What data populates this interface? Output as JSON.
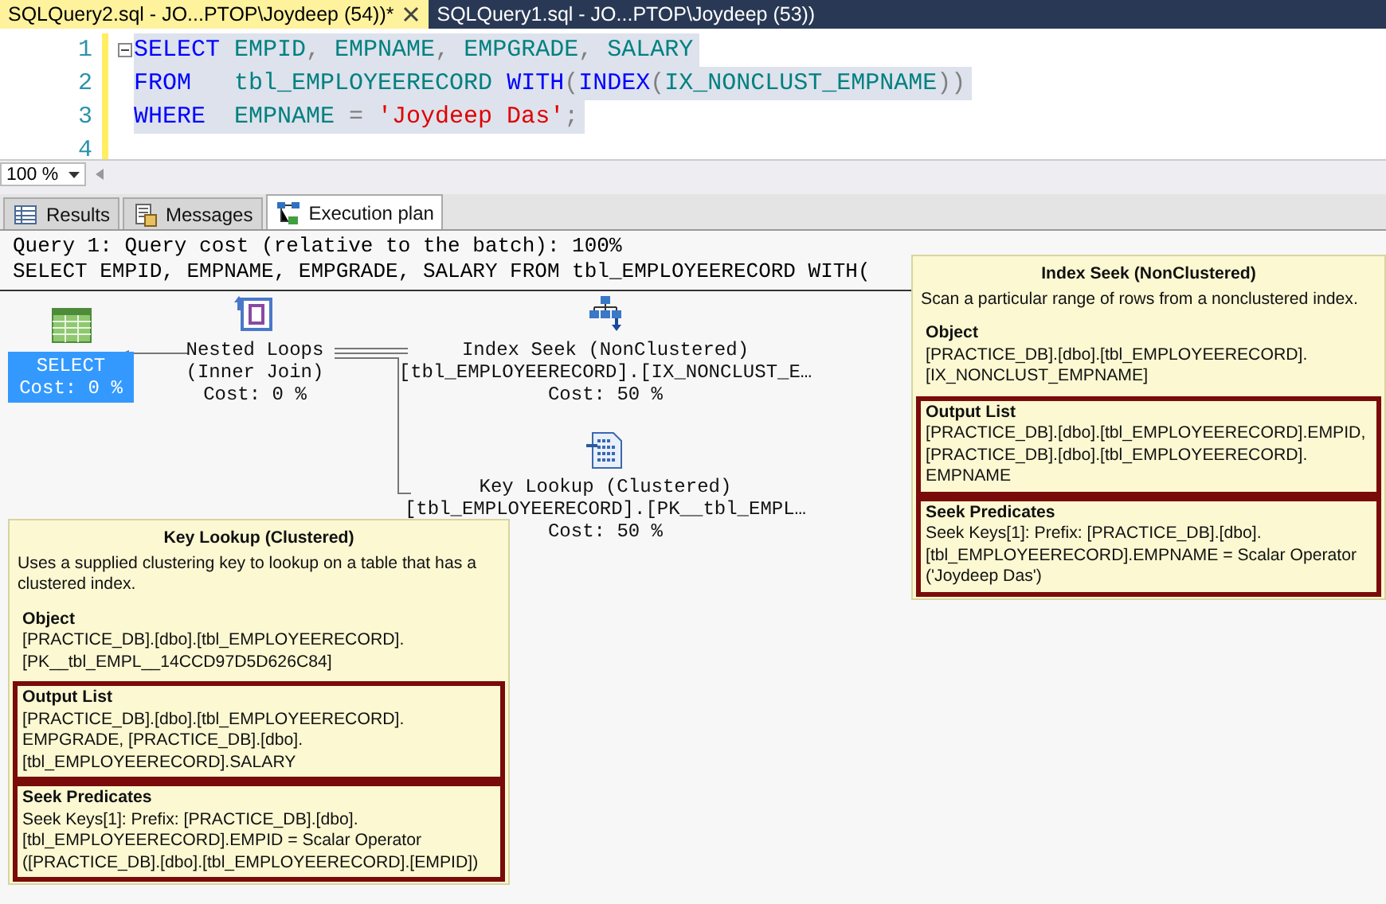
{
  "editor_tabs": [
    {
      "label": "SQLQuery2.sql - JO...PTOP\\Joydeep (54))*",
      "selected": true
    },
    {
      "label": "SQLQuery1.sql - JO...PTOP\\Joydeep (53))",
      "selected": false
    }
  ],
  "editor": {
    "lines": [
      {
        "number": "1",
        "selected": true,
        "tokens": [
          {
            "kind": "keyword",
            "text": "SELECT"
          },
          {
            "kind": "ident",
            "text": " EMPID"
          },
          {
            "kind": "punct",
            "text": ", "
          },
          {
            "kind": "ident",
            "text": "EMPNAME"
          },
          {
            "kind": "punct",
            "text": ", "
          },
          {
            "kind": "ident",
            "text": "EMPGRADE"
          },
          {
            "kind": "punct",
            "text": ", "
          },
          {
            "kind": "ident",
            "text": "SALARY"
          }
        ]
      },
      {
        "number": "2",
        "selected": true,
        "tokens": [
          {
            "kind": "keyword",
            "text": "FROM"
          },
          {
            "kind": "ident",
            "text": "   tbl_EMPLOYEERECORD "
          },
          {
            "kind": "keyword",
            "text": "WITH"
          },
          {
            "kind": "punct",
            "text": "("
          },
          {
            "kind": "keyword",
            "text": "INDEX"
          },
          {
            "kind": "punct",
            "text": "("
          },
          {
            "kind": "ident",
            "text": "IX_NONCLUST_EMPNAME"
          },
          {
            "kind": "punct",
            "text": "))"
          }
        ]
      },
      {
        "number": "3",
        "selected": true,
        "tokens": [
          {
            "kind": "keyword",
            "text": "WHERE"
          },
          {
            "kind": "ident",
            "text": "  EMPNAME "
          },
          {
            "kind": "punct",
            "text": "= "
          },
          {
            "kind": "string",
            "text": "'Joydeep Das'"
          },
          {
            "kind": "punct",
            "text": ";"
          }
        ]
      },
      {
        "number": "4",
        "selected": false
      }
    ]
  },
  "zoom": {
    "value": "100 %"
  },
  "result_tabs": [
    {
      "kind": "results",
      "label": "Results",
      "selected": false
    },
    {
      "kind": "messages",
      "label": "Messages",
      "selected": false
    },
    {
      "kind": "plan",
      "label": "Execution plan",
      "selected": true
    }
  ],
  "plan": {
    "header": [
      "Query 1: Query cost (relative to the batch): 100%",
      "SELECT EMPID, EMPNAME, EMPGRADE, SALARY FROM tbl_EMPLOYEERECORD WITH("
    ],
    "nodes": [
      {
        "kind": "select",
        "selected": true,
        "lines": [
          "SELECT",
          "Cost: 0 %"
        ]
      },
      {
        "kind": "nested_loops",
        "selected": false,
        "lines": [
          "Nested Loops",
          "(Inner Join)",
          "Cost: 0 %"
        ]
      },
      {
        "kind": "index_seek",
        "selected": false,
        "lines": [
          "Index Seek (NonClustered)",
          "[tbl_EMPLOYEERECORD].[IX_NONCLUST_E…",
          "Cost: 50 %"
        ]
      },
      {
        "kind": "key_lookup",
        "selected": false,
        "lines": [
          "Key Lookup (Clustered)",
          "[tbl_EMPLOYEERECORD].[PK__tbl_EMPL…",
          "Cost: 50 %"
        ]
      }
    ],
    "tooltips": [
      {
        "title": "Index Seek (NonClustered)",
        "description": "Scan a particular range of rows from a nonclustered index.",
        "sections": [
          {
            "label": "Object",
            "value": "[PRACTICE_DB].[dbo].[tbl_EMPLOYEERECORD].[IX_NONCLUST_EMPNAME]",
            "highlighted": false
          },
          {
            "label": "Output List",
            "value": "[PRACTICE_DB].[dbo].[tbl_EMPLOYEERECORD].EMPID, [PRACTICE_DB].[dbo].[tbl_EMPLOYEERECORD].EMPNAME",
            "highlighted": true
          },
          {
            "label": "Seek Predicates",
            "value": "Seek Keys[1]: Prefix: [PRACTICE_DB].[dbo].[tbl_EMPLOYEERECORD].EMPNAME = Scalar Operator ('Joydeep Das')",
            "highlighted": true
          }
        ]
      },
      {
        "title": "Key Lookup (Clustered)",
        "description": "Uses a supplied clustering key to lookup on a table that has a clustered index.",
        "sections": [
          {
            "label": "Object",
            "value": "[PRACTICE_DB].[dbo].[tbl_EMPLOYEERECORD].[PK__tbl_EMPL__14CCD97D5D626C84]",
            "highlighted": false
          },
          {
            "label": "Output List",
            "value": "[PRACTICE_DB].[dbo].[tbl_EMPLOYEERECORD].EMPGRADE, [PRACTICE_DB].[dbo].[tbl_EMPLOYEERECORD].SALARY",
            "highlighted": true
          },
          {
            "label": "Seek Predicates",
            "value": "Seek Keys[1]: Prefix: [PRACTICE_DB].[dbo].[tbl_EMPLOYEERECORD].EMPID = Scalar Operator ([PRACTICE_DB].[dbo].[tbl_EMPLOYEERECORD].[EMPID])",
            "highlighted": true
          }
        ]
      }
    ]
  }
}
